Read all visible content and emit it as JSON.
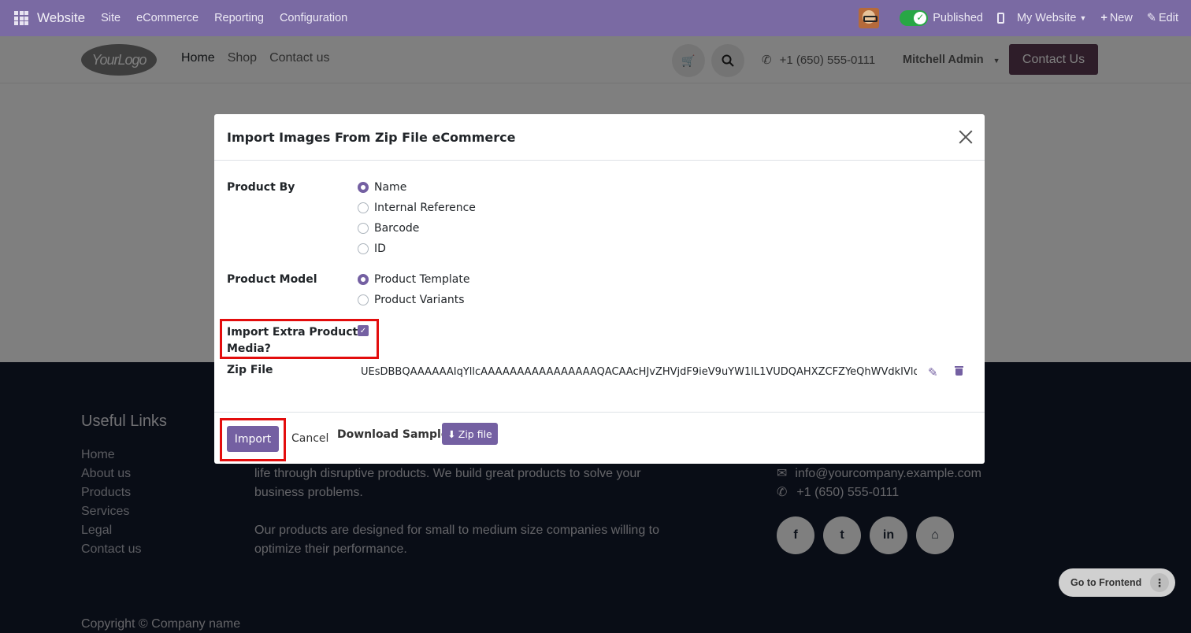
{
  "topbar": {
    "brand": "Website",
    "menu": [
      "Site",
      "eCommerce",
      "Reporting",
      "Configuration"
    ],
    "published": "Published",
    "my_website": "My Website",
    "new_label": "New",
    "edit_label": "Edit"
  },
  "site_header": {
    "logo_text": "YourLogo",
    "nav": [
      "Home",
      "Shop",
      "Contact us"
    ],
    "phone": "+1 (650) 555-0111",
    "user": "Mitchell Admin",
    "contact_button": "Contact Us"
  },
  "footer": {
    "useful_links_title": "Useful Links",
    "links": [
      "Home",
      "About us",
      "Products",
      "Services",
      "Legal",
      "Contact us"
    ],
    "about_line1": "life through disruptive products. We build great products to solve your business problems.",
    "about_line2": "Our products are designed for small to medium size companies willing to optimize their performance.",
    "email": "info@yourcompany.example.com",
    "phone": "+1 (650) 555-0111",
    "copyright": "Copyright © Company name"
  },
  "goto_frontend": "Go to Frontend",
  "modal": {
    "title": "Import Images From Zip File eCommerce",
    "product_by_label": "Product By",
    "product_by_options": [
      "Name",
      "Internal Reference",
      "Barcode",
      "ID"
    ],
    "product_by_selected": "Name",
    "product_model_label": "Product Model",
    "product_model_options": [
      "Product Template",
      "Product Variants"
    ],
    "product_model_selected": "Product Template",
    "extra_media_label_1": "Import Extra Product",
    "extra_media_label_2": "Media?",
    "extra_media_checked": true,
    "zip_file_label": "Zip File",
    "zip_file_value": "UEsDBBQAAAAAAIqYllcAAAAAAAAAAAAAAAAQACAAcHJvZHVjdF9ieV9uYW1lL1VUDQAHXZCFZYeQhWVdkIVldXgLAAEE",
    "import_button": "Import",
    "cancel_button": "Cancel",
    "download_sample_label": "Download Sample:",
    "zip_sample_button": "Zip file"
  },
  "colors": {
    "topbar": "#7a6aa3",
    "primary": "#7460a2",
    "highlight": "#e30d0d"
  }
}
